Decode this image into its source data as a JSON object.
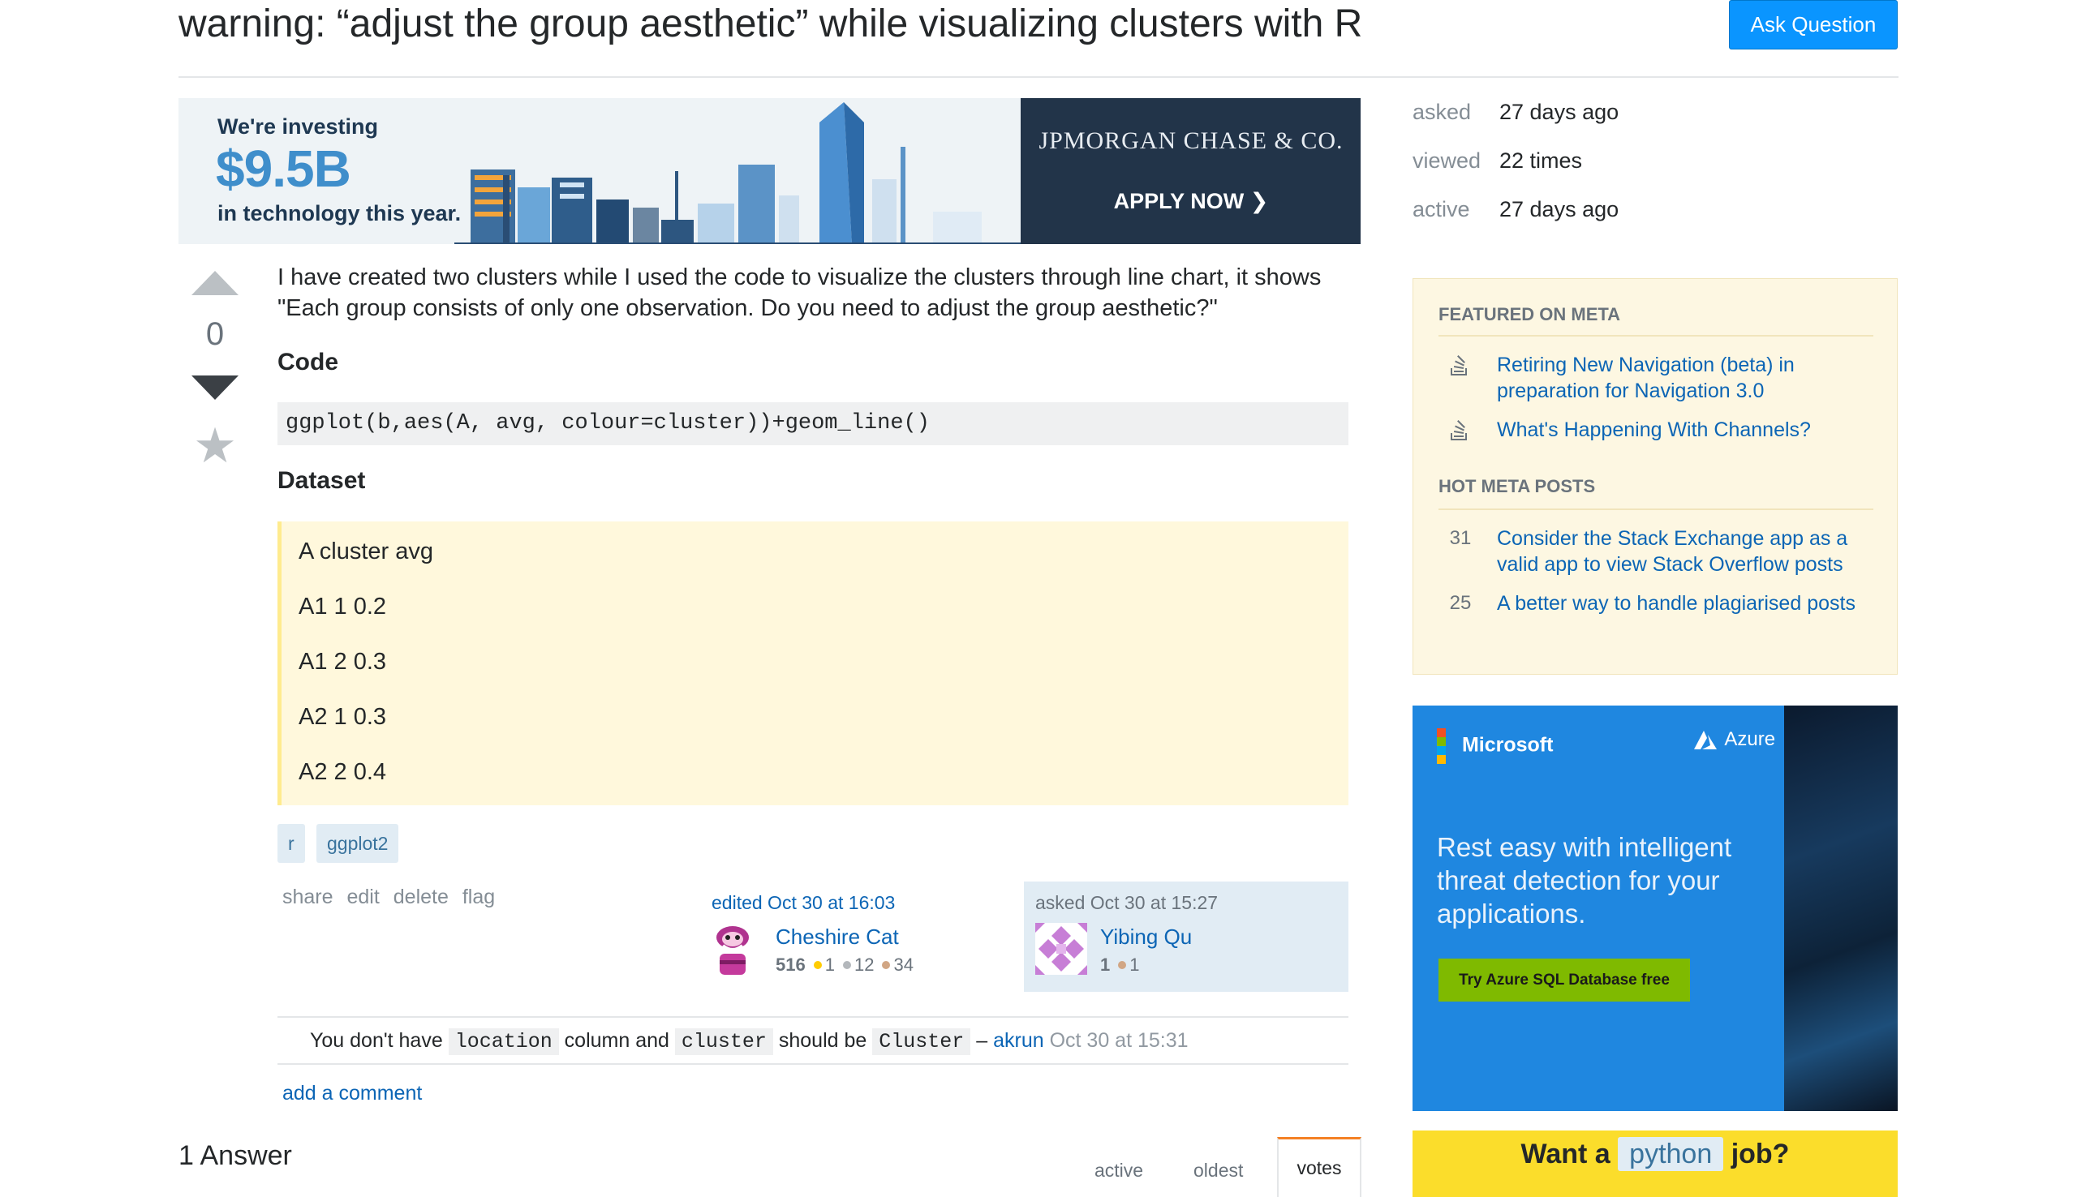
{
  "question": {
    "title": "warning: “adjust the group aesthetic” while visualizing clusters with R",
    "vote_count": "0",
    "body_intro": "I have created two clusters while I used the code to visualize the clusters through line chart, it shows \"Each group consists of only one observation. Do you need to adjust the group aesthetic?\"",
    "code_heading": "Code",
    "code": "ggplot(b,aes(A, avg, colour=cluster))+geom_line()",
    "dataset_heading": "Dataset",
    "dataset_lines": [
      "A cluster avg",
      "A1 1 0.2",
      "A1 2 0.3",
      "A2 1 0.3",
      "A2 2 0.4"
    ],
    "tags": [
      "r",
      "ggplot2"
    ],
    "menu": [
      "share",
      "edit",
      "delete",
      "flag"
    ],
    "edited": {
      "label": "edited Oct 30 at 16:03",
      "user": "Cheshire Cat",
      "reputation": "516",
      "gold": "1",
      "silver": "12",
      "bronze": "34"
    },
    "asked": {
      "label": "asked Oct 30 at 15:27",
      "user": "Yibing Qu",
      "reputation": "1",
      "bronze": "1"
    }
  },
  "header": {
    "ask_button": "Ask Question"
  },
  "ad_top": {
    "line1": "We're investing",
    "amount": "$9.5B",
    "line3": "in technology this year.",
    "brand": "JPMORGAN CHASE & CO.",
    "cta": "APPLY NOW ❯"
  },
  "comment": {
    "t1": "You don't have",
    "c1": "location",
    "t2": "column and",
    "c2": "cluster",
    "t3": "should be",
    "c3": "Cluster",
    "dash": "–",
    "author": "akrun",
    "time": "Oct 30 at 15:31"
  },
  "add_comment": "add a comment",
  "answers": {
    "count_label": "1 Answer",
    "sort_tabs": [
      "active",
      "oldest",
      "votes"
    ]
  },
  "sidebar": {
    "stats": [
      {
        "label": "asked",
        "value": "27 days ago"
      },
      {
        "label": "viewed",
        "value": "22 times"
      },
      {
        "label": "active",
        "value": "27 days ago"
      }
    ],
    "featured_heading": "FEATURED ON META",
    "featured": [
      "Retiring New Navigation (beta) in preparation for Navigation 3.0",
      "What's Happening With Channels?"
    ],
    "hot_heading": "HOT META POSTS",
    "hot": [
      {
        "score": "31",
        "title": "Consider the Stack Exchange app as a valid app to view Stack Overflow posts"
      },
      {
        "score": "25",
        "title": "A better way to handle plagiarised posts"
      }
    ]
  },
  "ad_azure": {
    "brand": "Microsoft",
    "product": "Azure",
    "text": "Rest easy with intelligent threat detection for your applications.",
    "cta": "Try Azure SQL Database free"
  },
  "jobs": {
    "pre": "Want a",
    "tag": "python",
    "post": "job?"
  },
  "colors": {
    "accent": "#0a95ff",
    "link": "#0c65b5",
    "tag_bg": "#e1ecf4",
    "quote_bg": "#fff8dc",
    "jobs_bg": "#fbdd2b"
  }
}
